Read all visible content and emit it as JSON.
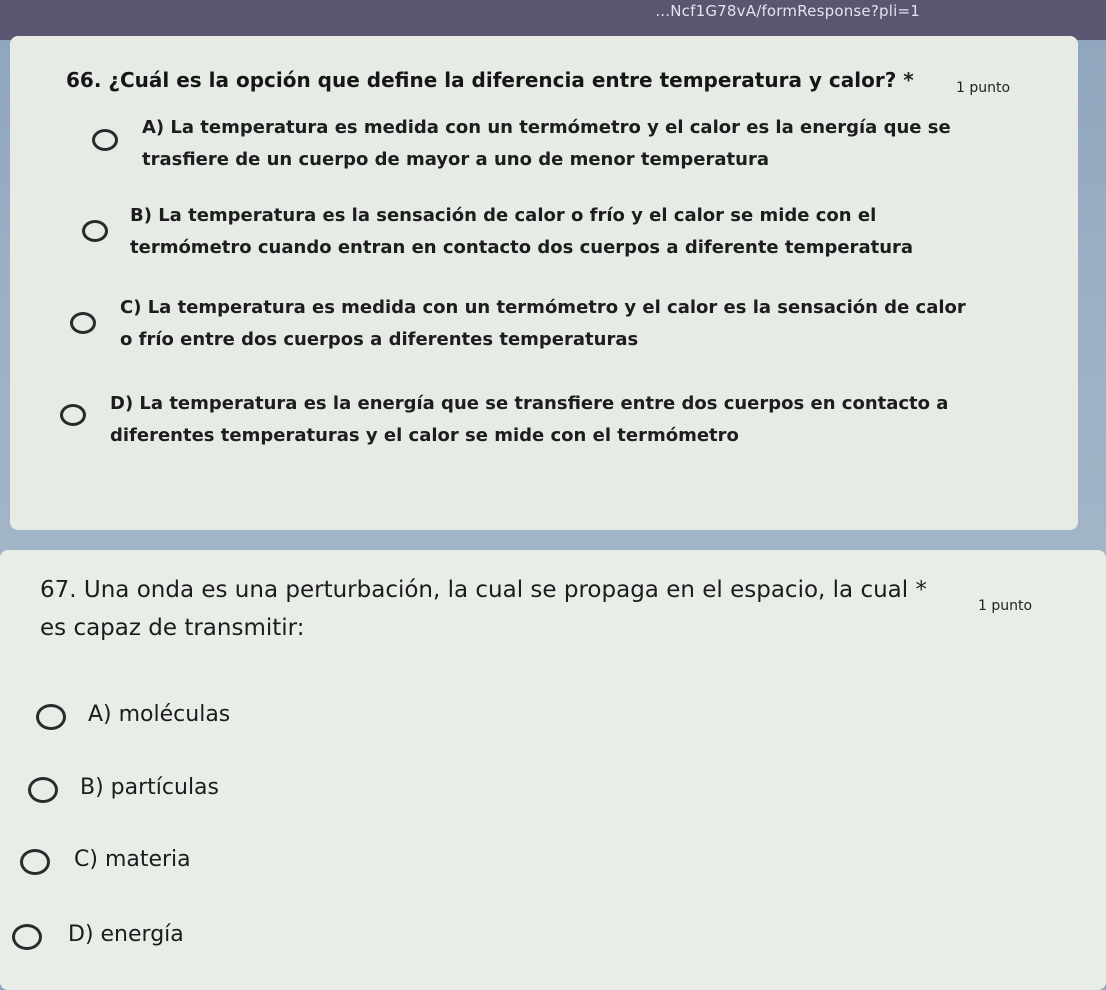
{
  "browser": {
    "url_fragment": "...Ncf1G78vA/formResponse?pli=1"
  },
  "q66": {
    "title": "66. ¿Cuál es la opción que define la diferencia entre temperatura y calor?",
    "required_mark": "*",
    "points": "1 punto",
    "options": [
      {
        "line1": "A) La temperatura es medida con un termómetro y el calor es la energía que se",
        "line2": "trasfiere de un cuerpo de mayor a uno de menor temperatura"
      },
      {
        "line1": "B) La temperatura es la sensación de calor o frío y el calor se mide con el",
        "line2": "termómetro cuando entran en contacto dos cuerpos a diferente temperatura"
      },
      {
        "line1": "C) La temperatura es medida con un termómetro y el calor es la sensación de calor",
        "line2": "o frío entre dos cuerpos a diferentes temperaturas"
      },
      {
        "line1": "D) La temperatura es la energía que se transfiere entre dos cuerpos en contacto a",
        "line2": "diferentes temperaturas y el calor se mide con el termómetro"
      }
    ]
  },
  "q67": {
    "title_line1": "67. Una onda es una perturbación, la cual se propaga en el espacio, la cual",
    "title_line2": "es capaz de transmitir:",
    "required_mark": "*",
    "points": "1 punto",
    "options": [
      "A) moléculas",
      "B) partículas",
      "C) materia",
      "D) energía"
    ]
  }
}
